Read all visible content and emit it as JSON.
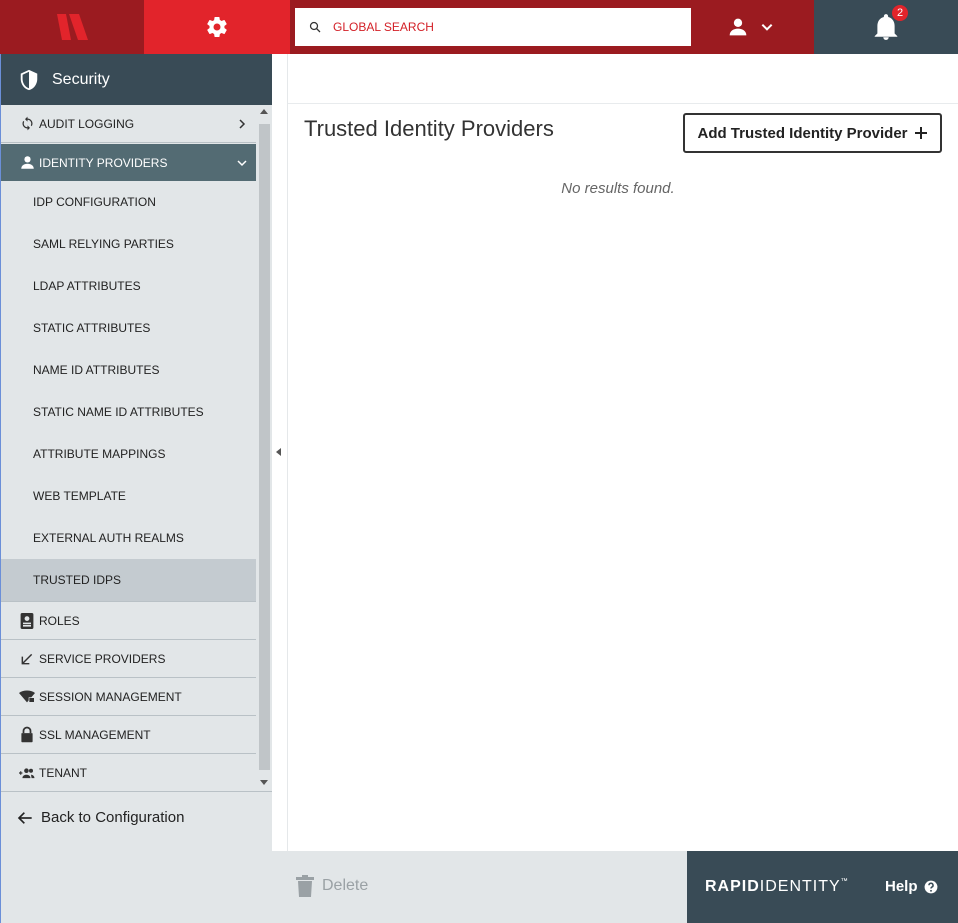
{
  "topbar": {
    "search": {
      "placeholder": "GLOBAL SEARCH"
    },
    "notifications": {
      "count": "2"
    }
  },
  "sidebar": {
    "header": "Security",
    "items": [
      {
        "label": "AUDIT LOGGING",
        "icon": "sync-icon"
      },
      {
        "label": "IDENTITY PROVIDERS",
        "icon": "person-icon",
        "expanded": true
      },
      {
        "label": "IDP CONFIGURATION"
      },
      {
        "label": "SAML RELYING PARTIES"
      },
      {
        "label": "LDAP ATTRIBUTES"
      },
      {
        "label": "STATIC ATTRIBUTES"
      },
      {
        "label": "NAME ID ATTRIBUTES"
      },
      {
        "label": "STATIC NAME ID ATTRIBUTES"
      },
      {
        "label": "ATTRIBUTE MAPPINGS"
      },
      {
        "label": "WEB TEMPLATE"
      },
      {
        "label": "EXTERNAL AUTH REALMS"
      },
      {
        "label": "TRUSTED IDPS",
        "selected": true
      },
      {
        "label": "ROLES",
        "icon": "badge-icon"
      },
      {
        "label": "SERVICE PROVIDERS",
        "icon": "arrow-down-left-icon"
      },
      {
        "label": "SESSION MANAGEMENT",
        "icon": "wifi-lock-icon"
      },
      {
        "label": "SSL MANAGEMENT",
        "icon": "lock-icon"
      },
      {
        "label": "TENANT",
        "icon": "group-add-icon"
      }
    ],
    "back": "Back to Configuration"
  },
  "main": {
    "title": "Trusted Identity Providers",
    "add_button": "Add Trusted Identity Provider",
    "empty_message": "No results found."
  },
  "footer": {
    "delete": "Delete",
    "brand_bold": "RAPID",
    "brand_light": "IDENTITY",
    "brand_tm": "™",
    "help": "Help"
  },
  "colors": {
    "brand_red": "#e2242b",
    "dark_red": "#9b1b20",
    "slate": "#394b56",
    "active_row": "#536b73"
  }
}
